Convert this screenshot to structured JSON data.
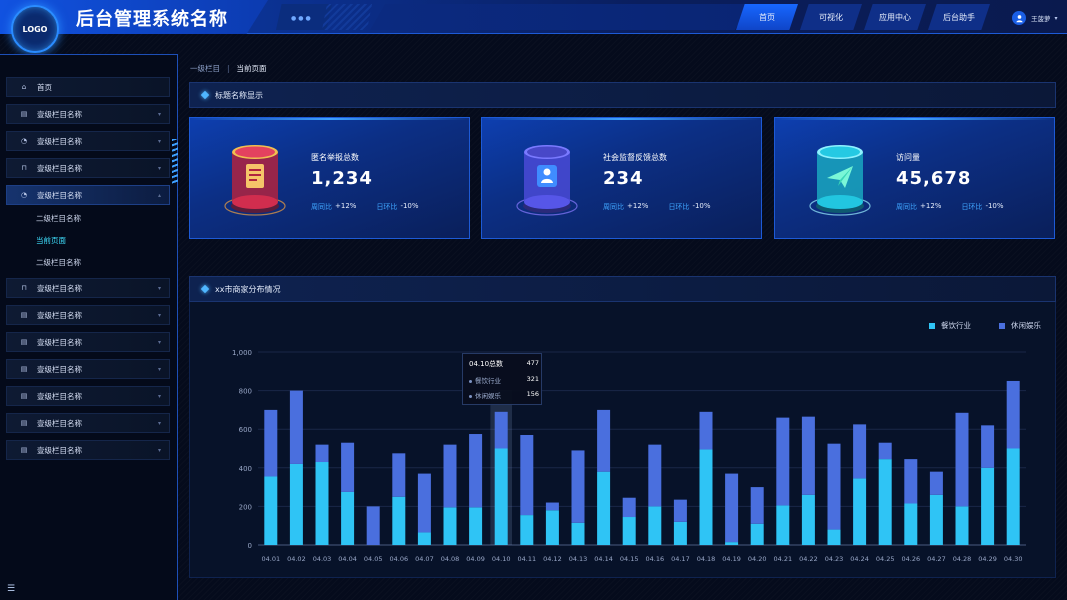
{
  "app": {
    "title": "后台管理系统名称",
    "logo": "LOGO"
  },
  "nav": {
    "items": [
      {
        "label": "首页",
        "active": true
      },
      {
        "label": "可视化",
        "active": false
      },
      {
        "label": "应用中心",
        "active": false
      },
      {
        "label": "后台助手",
        "active": false
      }
    ],
    "user_name": "王菠萝"
  },
  "sidebar": {
    "items": [
      {
        "label": "首页",
        "icon": "home-icon"
      },
      {
        "label": "壹级栏目名称",
        "icon": "doc-icon"
      },
      {
        "label": "壹级栏目名称",
        "icon": "pie-icon"
      },
      {
        "label": "壹级栏目名称",
        "icon": "lock-icon"
      },
      {
        "label": "壹级栏目名称",
        "icon": "pie-icon",
        "expanded": true
      },
      {
        "label": "壹级栏目名称",
        "icon": "lock-icon"
      },
      {
        "label": "壹级栏目名称",
        "icon": "doc-icon"
      },
      {
        "label": "壹级栏目名称",
        "icon": "doc-icon"
      },
      {
        "label": "壹级栏目名称",
        "icon": "doc-icon"
      },
      {
        "label": "壹级栏目名称",
        "icon": "doc-icon"
      },
      {
        "label": "壹级栏目名称",
        "icon": "doc-icon"
      },
      {
        "label": "壹级栏目名称",
        "icon": "doc-icon"
      }
    ],
    "sub_items": [
      {
        "label": "二级栏目名称",
        "active": false
      },
      {
        "label": "当前页面",
        "active": true
      },
      {
        "label": "二级栏目名称",
        "active": false
      }
    ]
  },
  "breadcrumb": {
    "level1": "一级栏目",
    "separator": "|",
    "current": "当前页面"
  },
  "stats_panel": {
    "title": "标题名称显示",
    "cards": [
      {
        "label": "匿名举报总数",
        "value": "1,234",
        "week_label": "周同比",
        "week_value": "+12%",
        "day_label": "日环比",
        "day_value": "-10%",
        "icon": "report-icon",
        "accent": "#e0335a"
      },
      {
        "label": "社会监督反馈总数",
        "value": "234",
        "week_label": "周同比",
        "week_value": "+12%",
        "day_label": "日环比",
        "day_value": "-10%",
        "icon": "person-card-icon",
        "accent": "#6a5cff"
      },
      {
        "label": "访问量",
        "value": "45,678",
        "week_label": "周同比",
        "week_value": "+12%",
        "day_label": "日环比",
        "day_value": "-10%",
        "icon": "paper-plane-icon",
        "accent": "#22d3e6"
      }
    ]
  },
  "chart_panel": {
    "title": "xx市商家分布情况"
  },
  "tooltip": {
    "title": "04.10总数",
    "total": "477",
    "rows": [
      {
        "name": "餐饮行业",
        "value": "321"
      },
      {
        "name": "休闲娱乐",
        "value": "156"
      }
    ]
  },
  "colors": {
    "accent": "#1767ff",
    "series1": "#2fc4f5",
    "series2": "#4a6fde"
  },
  "chart_data": {
    "type": "bar",
    "stacked": true,
    "categories": [
      "04.01",
      "04.02",
      "04.03",
      "04.04",
      "04.05",
      "04.06",
      "04.07",
      "04.08",
      "04.09",
      "04.10",
      "04.11",
      "04.12",
      "04.13",
      "04.14",
      "04.15",
      "04.16",
      "04.17",
      "04.18",
      "04.19",
      "04.20",
      "04.21",
      "04.22",
      "04.23",
      "04.24",
      "04.25",
      "04.26",
      "04.27",
      "04.28",
      "04.29",
      "04.30"
    ],
    "series": [
      {
        "name": "餐饮行业",
        "color": "#2fc4f5",
        "values": [
          355,
          420,
          430,
          275,
          0,
          250,
          65,
          195,
          195,
          500,
          155,
          180,
          115,
          380,
          145,
          200,
          120,
          495,
          15,
          110,
          205,
          260,
          80,
          345,
          445,
          215,
          260,
          200,
          400,
          500
        ]
      },
      {
        "name": "休闲娱乐",
        "color": "#4a6fde",
        "values": [
          345,
          380,
          90,
          255,
          200,
          225,
          305,
          325,
          380,
          190,
          415,
          40,
          375,
          320,
          100,
          320,
          115,
          195,
          355,
          190,
          455,
          405,
          445,
          280,
          85,
          230,
          120,
          485,
          220,
          350
        ]
      }
    ],
    "yticks": [
      0,
      200,
      400,
      600,
      800,
      1000
    ],
    "yticklabels": [
      "0",
      "200",
      "400",
      "600",
      "800",
      "1,000"
    ],
    "ylim": [
      0,
      1000
    ],
    "grid": true,
    "legend": "top-right",
    "highlight_index": 9
  }
}
